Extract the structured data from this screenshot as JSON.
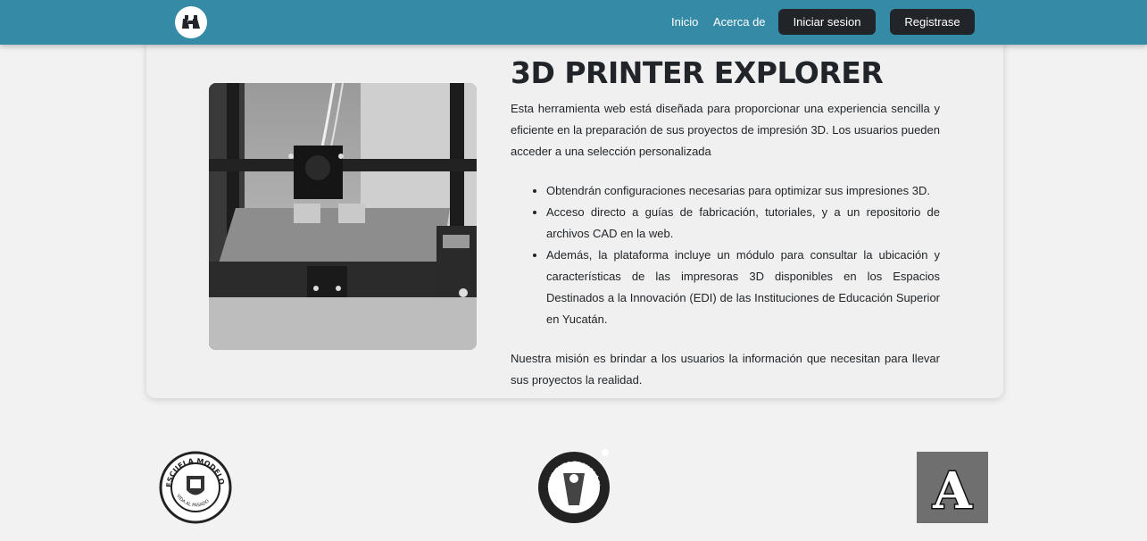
{
  "nav": {
    "logo_icon": "binoculars-icon",
    "links": [
      "Inicio",
      "Acerca de"
    ],
    "login_label": "Iniciar sesion",
    "register_label": "Registrase"
  },
  "hero": {
    "title": "3D PRINTER EXPLORER",
    "intro": "Esta herramienta web está diseñada para proporcionar una experiencia sencilla y eficiente en la preparación de sus proyectos de impresión 3D. Los usuarios pueden acceder a una selección personalizada",
    "features": [
      "Obtendrán configuraciones necesarias para optimizar sus impresiones 3D.",
      "Acceso directo a guías de fabricación, tutoriales, y a un repositorio de archivos CAD en la web.",
      "Además, la plataforma incluye un módulo para consultar la ubicación y características de las impresoras 3D disponibles en los Espacios Destinados a la Innovación (EDI) de las Instituciones de Educación Superior en Yucatán."
    ],
    "mission": "Nuestra misión es brindar a los usuarios la información que necesitan para llevar sus proyectos la realidad."
  },
  "partners": {
    "escuela_modelo": {
      "name": "ESCUELA MODELO",
      "motto": "VIDA AL PASADO"
    },
    "tec_merida": {
      "name": "INSTITUTO TECNOLÓGICO",
      "city": "MÉRIDA YUCATÁN"
    },
    "anahuac": {
      "letter": "A"
    }
  }
}
